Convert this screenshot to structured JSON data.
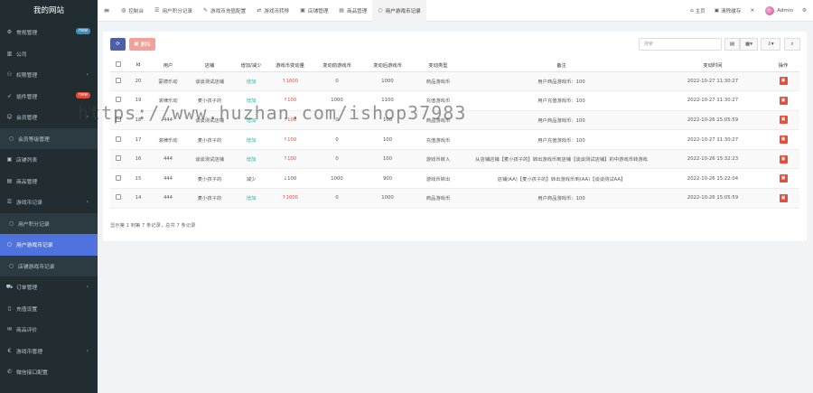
{
  "app": {
    "title": "我的网站"
  },
  "sidebar": {
    "items": [
      {
        "label": "常规管理",
        "icon": "gear-icon",
        "badge": "new",
        "badge_color": "#3c8dbc",
        "chevron": false,
        "type": "normal"
      },
      {
        "label": "公司",
        "icon": "building-icon",
        "badge": "",
        "chevron": false,
        "type": "normal"
      },
      {
        "label": "权限管理",
        "icon": "users-icon",
        "badge": "",
        "chevron": true,
        "type": "normal"
      },
      {
        "label": "插件管理",
        "icon": "rocket-icon",
        "badge": "new",
        "badge_color": "#dd4b39",
        "chevron": false,
        "type": "normal"
      },
      {
        "label": "会员管理",
        "icon": "user-icon",
        "badge": "",
        "chevron": true,
        "type": "normal"
      },
      {
        "label": "会员等级管理",
        "icon": "circle-icon",
        "badge": "",
        "chevron": false,
        "type": "sub"
      },
      {
        "label": "店铺列表",
        "icon": "store-icon",
        "badge": "",
        "chevron": false,
        "type": "normal"
      },
      {
        "label": "商品管理",
        "icon": "box-icon",
        "badge": "",
        "chevron": false,
        "type": "normal"
      },
      {
        "label": "游戏币记录",
        "icon": "list-icon",
        "badge": "",
        "chevron": true,
        "type": "normal"
      },
      {
        "label": "用户积分记录",
        "icon": "circle-icon",
        "badge": "",
        "chevron": false,
        "type": "sub"
      },
      {
        "label": "用户游戏币记录",
        "icon": "circle-icon",
        "badge": "",
        "chevron": false,
        "type": "active"
      },
      {
        "label": "店铺游戏币记录",
        "icon": "circle-icon",
        "badge": "",
        "chevron": false,
        "type": "sub"
      },
      {
        "label": "订单管理",
        "icon": "cart-icon",
        "badge": "",
        "chevron": true,
        "type": "normal"
      },
      {
        "label": "充值设置",
        "icon": "file-icon",
        "badge": "",
        "chevron": false,
        "type": "normal"
      },
      {
        "label": "商品评价",
        "icon": "comment-icon",
        "badge": "",
        "chevron": false,
        "type": "normal"
      },
      {
        "label": "游戏币管理",
        "icon": "coin-icon",
        "badge": "",
        "chevron": true,
        "type": "normal"
      },
      {
        "label": "微信接口配置",
        "icon": "wechat-icon",
        "badge": "",
        "chevron": false,
        "type": "normal"
      }
    ]
  },
  "topbar": {
    "tabs": [
      {
        "label": "控制台",
        "icon": "dashboard-icon",
        "active": false
      },
      {
        "label": "用户积分记录",
        "icon": "list-icon",
        "active": false
      },
      {
        "label": "游戏币充值配置",
        "icon": "edit-icon",
        "active": false
      },
      {
        "label": "游戏币转移",
        "icon": "exchange-icon",
        "active": false
      },
      {
        "label": "店铺管理",
        "icon": "store-icon",
        "active": false
      },
      {
        "label": "商品管理",
        "icon": "box-icon",
        "active": false
      },
      {
        "label": "用户游戏币记录",
        "icon": "circle-icon",
        "active": true
      }
    ],
    "home_label": "主页",
    "clear_cache_label": "清除缓存",
    "user_name": "Admin"
  },
  "toolbar": {
    "refresh_icon": "refresh-icon",
    "delete_label": "删除",
    "search_placeholder": "搜索"
  },
  "table": {
    "headers": [
      "",
      "Id",
      "用户",
      "店铺",
      "增加/减少",
      "游戏币变动量",
      "变动前游戏币",
      "变动后游戏币",
      "变动类型",
      "备注",
      "变动时间",
      "操作"
    ],
    "rows": [
      {
        "id": "20",
        "user": "蒙德乐动",
        "shop": "谈谈测试店铺",
        "dir": "增加",
        "amount": "↑1000",
        "before": "0",
        "after": "1000",
        "type": "商品游戏币",
        "note": "用户商品游戏币：100",
        "time": "2022-10-27 11:30:27"
      },
      {
        "id": "19",
        "user": "滚律乐动",
        "shop": "麦小孩子的",
        "dir": "增加",
        "amount": "↑100",
        "before": "1000",
        "after": "1100",
        "type": "充值游戏币",
        "note": "用户充值游戏币：100",
        "time": "2022-10-27 11:30:27"
      },
      {
        "id": "18",
        "user": "444",
        "shop": "谈谈测试店铺",
        "dir": "增加",
        "amount": "↑100",
        "before": "0",
        "after": "100",
        "type": "商品游戏币",
        "note": "用户商品游戏币：100",
        "time": "2022-10-26 15:05:59"
      },
      {
        "id": "17",
        "user": "滚律乐动",
        "shop": "麦小孩子的",
        "dir": "增加",
        "amount": "↑100",
        "before": "0",
        "after": "100",
        "type": "充值游戏币",
        "note": "用户充值游戏币：100",
        "time": "2022-10-27 11:30:27"
      },
      {
        "id": "16",
        "user": "444",
        "shop": "谈谈测试店铺",
        "dir": "增加",
        "amount": "↑100",
        "before": "0",
        "after": "100",
        "type": "游戏币转入",
        "note": "从店铺店铺【麦小孩子的】转出游戏币到店铺【谈谈测试店铺】的中游戏币转游戏",
        "time": "2022-10-26 15:32:23"
      },
      {
        "id": "15",
        "user": "444",
        "shop": "麦小孩子的",
        "dir": "减少",
        "amount": "↓100",
        "before": "1000",
        "after": "900",
        "type": "游戏币转出",
        "note": "店铺(AA)【麦小孩子的】转出游戏币到(AA)【谈谈测试AA】",
        "time": "2022-10-26 15:22:04"
      },
      {
        "id": "14",
        "user": "444",
        "shop": "麦小孩子的",
        "dir": "增加",
        "amount": "↑1000",
        "before": "0",
        "after": "1000",
        "type": "商品游戏币",
        "note": "用户商品游戏币：100",
        "time": "2022-10-26 15:05:59"
      }
    ],
    "footer": "显示第 1 到第 7 条记录，总共 7 条记录"
  },
  "watermark": "https://www.huzhan.com/ishop37983"
}
